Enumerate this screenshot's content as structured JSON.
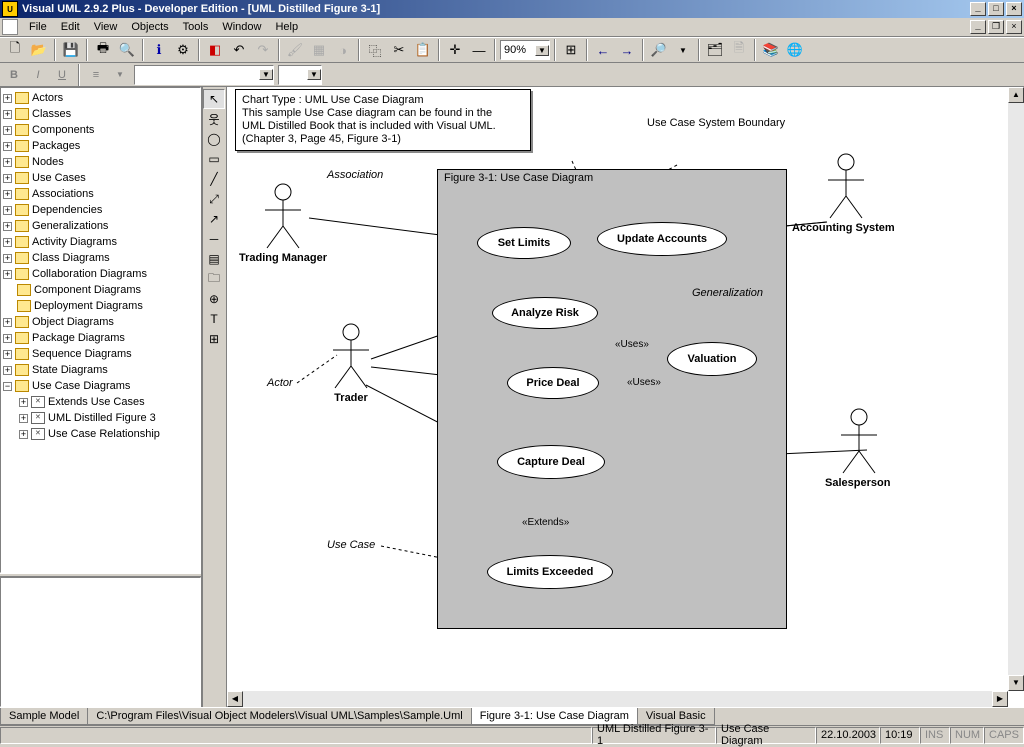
{
  "title": "Visual UML 2.9.2 Plus - Developer Edition - [UML Distilled Figure 3-1]",
  "menu": {
    "file": "File",
    "edit": "Edit",
    "view": "View",
    "objects": "Objects",
    "tools": "Tools",
    "window": "Window",
    "help": "Help"
  },
  "toolbar": {
    "zoom": "90%"
  },
  "tree": {
    "items": [
      "Actors",
      "Classes",
      "Components",
      "Packages",
      "Nodes",
      "Use Cases",
      "Associations",
      "Dependencies",
      "Generalizations",
      "Activity Diagrams",
      "Class Diagrams",
      "Collaboration Diagrams",
      "Component Diagrams",
      "Deployment Diagrams",
      "Object Diagrams",
      "Package Diagrams",
      "Sequence Diagrams",
      "State Diagrams",
      "Use Case Diagrams"
    ],
    "usecase_children": [
      "Extends Use Cases",
      "UML Distilled Figure 3",
      "Use Case Relationship"
    ]
  },
  "note": {
    "line1": "Chart Type : UML Use Case Diagram",
    "line2": "This sample Use Case diagram can be found in the",
    "line3": "UML Distilled Book that is included with Visual UML.",
    "line4": "(Chapter 3, Page 45, Figure 3-1)"
  },
  "diagram": {
    "boundary_hint": "Use Case System Boundary",
    "boundary_title": "Figure 3-1: Use Case Diagram",
    "actors": {
      "trading_manager": "Trading Manager",
      "trader": "Trader",
      "accounting_system": "Accounting System",
      "salesperson": "Salesperson"
    },
    "usecases": {
      "set_limits": "Set Limits",
      "update_accounts": "Update Accounts",
      "analyze_risk": "Analyze Risk",
      "valuation": "Valuation",
      "price_deal": "Price Deal",
      "capture_deal": "Capture Deal",
      "limits_exceeded": "Limits Exceeded"
    },
    "annotations": {
      "association": "Association",
      "actor": "Actor",
      "generalization": "Generalization",
      "use_case": "Use Case"
    },
    "stereotypes": {
      "uses1": "«Uses»",
      "uses2": "«Uses»",
      "extends": "«Extends»"
    }
  },
  "tabs": {
    "t1": "Sample Model",
    "t2": "C:\\Program Files\\Visual Object Modelers\\Visual UML\\Samples\\Sample.Uml",
    "t3": "Figure 3-1: Use Case Diagram",
    "t4": "Visual Basic"
  },
  "status": {
    "s1": "UML Distilled Figure 3-1",
    "s2": "Use Case Diagram",
    "s3": "22.10.2003",
    "s4": "10:19",
    "s5": "INS",
    "s6": "NUM",
    "s7": "CAPS"
  }
}
